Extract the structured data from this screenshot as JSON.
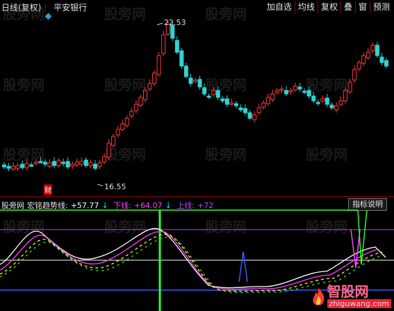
{
  "toolbar": {
    "period": "日线(复权)",
    "stock": "平安银行",
    "buttons": [
      "加自选",
      "均线",
      "复权",
      "叠",
      "窗",
      "预测"
    ]
  },
  "main_chart": {
    "high_label": "22.53",
    "low_label": "16.55",
    "caiwu_flag": "财"
  },
  "indicator": {
    "site": "股旁网",
    "name": "宏铭趋势线:",
    "value1": "+57.77",
    "label_lower": "下线:",
    "value_lower": "+64.07",
    "label_upper": "上线:",
    "value_upper": "+72",
    "help_button": "指标说明"
  },
  "watermark": "股旁网",
  "brand": {
    "name": "智股网",
    "url": "zhiguwang.com",
    "icon": "flame-icon"
  },
  "colors": {
    "up": "#ff3b3b",
    "down": "#2fd4d4",
    "line_white": "#ffffff",
    "line_yellow": "#ffff00",
    "line_magenta": "#ff40ff",
    "line_green": "#2aff2a",
    "line_blue": "#3b5bff",
    "ref_purple": "#c040ff"
  }
}
